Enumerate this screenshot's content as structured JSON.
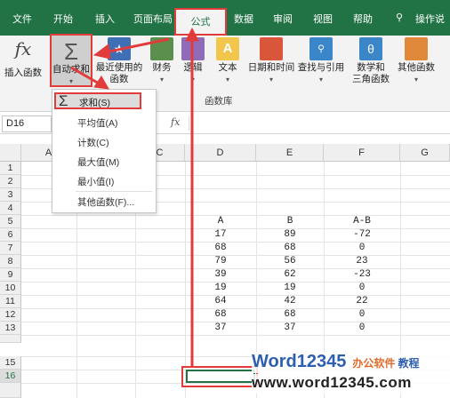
{
  "ribbon_tabs": [
    "文件",
    "开始",
    "插入",
    "页面布局",
    "公式",
    "数据",
    "审阅",
    "视图",
    "帮助",
    "操作说"
  ],
  "active_tab": "公式",
  "ribbon": {
    "insert_function": {
      "icon": "fx",
      "label": "插入函数"
    },
    "autosum": {
      "icon": "Σ",
      "label": "自动求和"
    },
    "recent": {
      "label1": "最近使用的",
      "label2": "函数"
    },
    "finance": {
      "label": "财务"
    },
    "logic": {
      "label": "逻辑"
    },
    "text": {
      "label": "文本"
    },
    "datetime": {
      "label": "日期和时间"
    },
    "lookup": {
      "label": "查找与引用"
    },
    "math": {
      "label1": "数学和",
      "label2": "三角函数"
    },
    "other": {
      "label": "其他函数"
    },
    "group_label": "函数库"
  },
  "formula_bar": {
    "name_box": "D16",
    "fx": "fx"
  },
  "autosum_menu": {
    "items": [
      "求和(S)",
      "平均值(A)",
      "计数(C)",
      "最大值(M)",
      "最小值(I)",
      "其他函数(F)..."
    ],
    "sigma": "Σ"
  },
  "columns": [
    "A",
    "C",
    "D",
    "E",
    "F",
    "G"
  ],
  "rows": [
    "1",
    "2",
    "3",
    "4",
    "5",
    "6",
    "7",
    "8",
    "9",
    "10",
    "11",
    "12",
    "13",
    "15",
    "16"
  ],
  "table": {
    "headers": [
      "A",
      "B",
      "A-B"
    ],
    "data": [
      [
        "17",
        "89",
        "-72"
      ],
      [
        "68",
        "68",
        "0"
      ],
      [
        "79",
        "56",
        "23"
      ],
      [
        "39",
        "62",
        "-23"
      ],
      [
        "19",
        "19",
        "0"
      ],
      [
        "64",
        "42",
        "22"
      ],
      [
        "68",
        "68",
        "0"
      ],
      [
        "37",
        "37",
        "0"
      ]
    ]
  },
  "watermark": {
    "brand_word": "Word12345",
    "brand_cn": "办公软件",
    "brand_tail": "教程",
    "url": "www.word12345.com"
  }
}
